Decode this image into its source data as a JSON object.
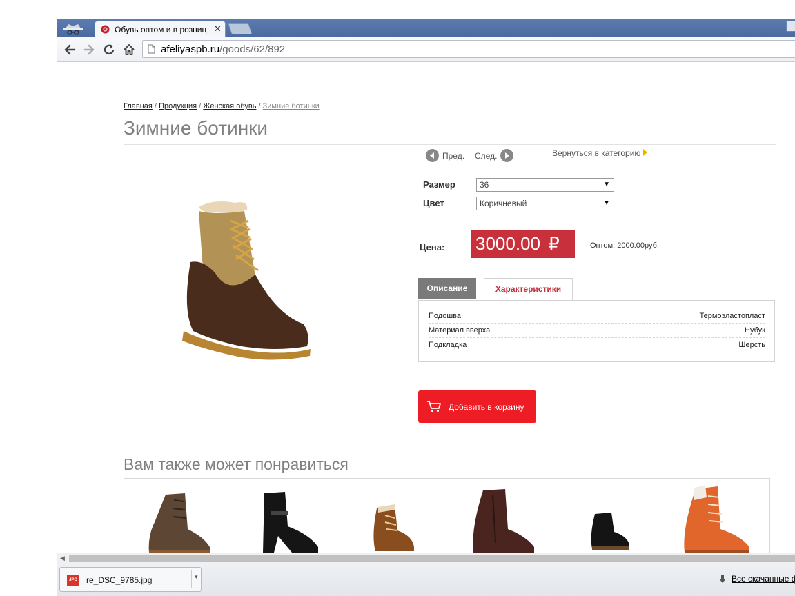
{
  "browser": {
    "tab_title": "Обувь оптом и в розниц",
    "url_domain": "afeliyaspb.ru",
    "url_path": "/goods/62/892"
  },
  "breadcrumb": {
    "home": "Главная",
    "products": "Продукция",
    "category": "Женская обувь",
    "current": "Зимние ботинки",
    "separator": "/"
  },
  "product": {
    "title": "Зимние ботинки",
    "prev": "Пред.",
    "next": "След.",
    "back_to_category": "Вернуться в категорию",
    "size_label": "Размер",
    "size_value": "36",
    "color_label": "Цвет",
    "color_value": "Коричневый",
    "price_label": "Цена:",
    "price_value": "3000.00",
    "currency": "₽",
    "wholesale": "Оптом: 2000.00руб.",
    "tabs": [
      {
        "label": "Описание",
        "active": false
      },
      {
        "label": "Характеристики",
        "active": true
      }
    ],
    "specs": [
      {
        "key": "Подошва",
        "value": "Термоэластопласт"
      },
      {
        "key": "Материал вверха",
        "value": "Нубук"
      },
      {
        "key": "Подкладка",
        "value": "Шерсть"
      }
    ],
    "add_to_cart": "Добавить в корзину"
  },
  "related": {
    "title": "Вам также может понравиться",
    "items": [
      "brown-lace-boot",
      "black-heel-boot",
      "brown-low-boot",
      "brown-leather-boot",
      "black-suede-boot",
      "orange-winter-boot"
    ]
  },
  "downloads": {
    "file_name": "re_DSC_9785.jpg",
    "file_badge": "JPG",
    "all_downloads": "Все скачанные ф"
  },
  "colors": {
    "price_bg": "#c8313b",
    "cart_bg": "#ee1c25",
    "tab_active_text": "#c0303a"
  }
}
